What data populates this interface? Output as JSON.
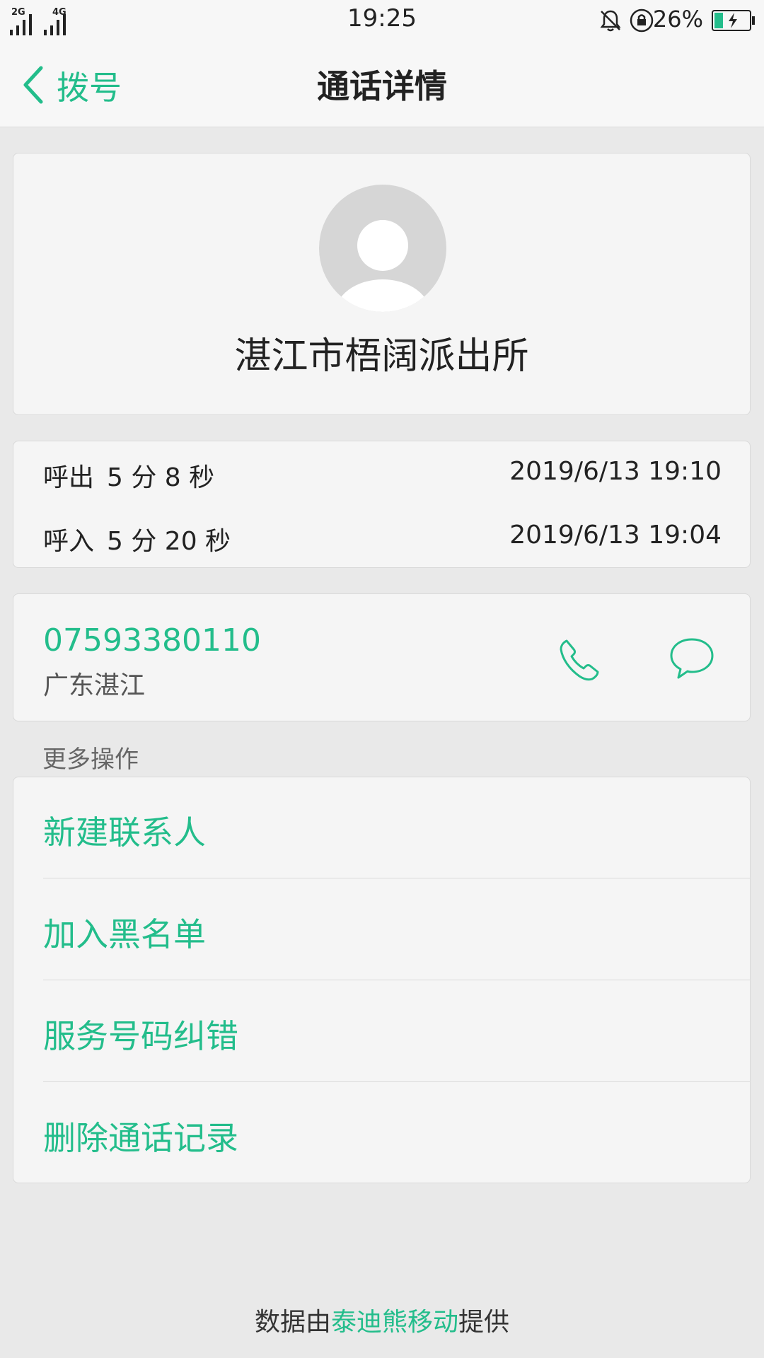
{
  "status_bar": {
    "signal1_label": "2G",
    "signal2_label": "4G",
    "time": "19:25",
    "battery_percent": "26%",
    "battery_level": 0.26,
    "icons": [
      "signal-icon",
      "signal-icon",
      "mute-bell-icon",
      "rotation-lock-icon",
      "battery-charging-icon"
    ]
  },
  "nav": {
    "back_label": "拨号",
    "title": "通话详情"
  },
  "contact": {
    "name": "湛江市梧阔派出所"
  },
  "calls": [
    {
      "type": "呼出",
      "duration": "5 分 8 秒",
      "time": "2019/6/13 19:10"
    },
    {
      "type": "呼入",
      "duration": "5 分 20 秒",
      "time": "2019/6/13 19:04"
    }
  ],
  "number": {
    "value": "07593380110",
    "location": "广东湛江"
  },
  "more_actions": {
    "title": "更多操作",
    "items": [
      "新建联系人",
      "加入黑名单",
      "服务号码纠错",
      "删除通话记录"
    ]
  },
  "footer": {
    "prefix": "数据由",
    "brand": "泰迪熊移动",
    "suffix": "提供"
  },
  "colors": {
    "accent": "#23bd8b",
    "background": "#e9e9e9",
    "card": "#f5f5f5"
  }
}
